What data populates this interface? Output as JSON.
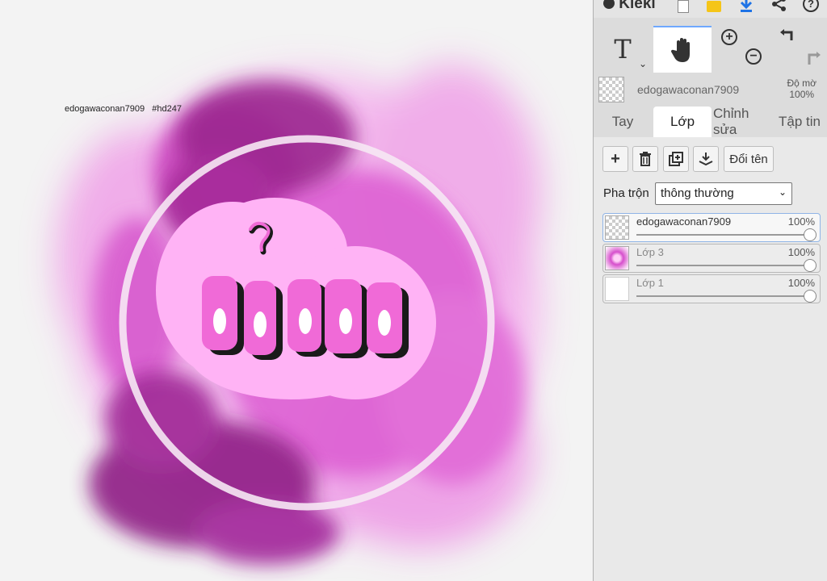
{
  "canvas": {
    "watermark": "edogawaconan7909   #hd247",
    "artwork_text": "ỏ lia",
    "colors": {
      "smoke_light": "#f0a6e8",
      "smoke_mid": "#d84fcf",
      "smoke_dark": "#9a1e8f",
      "badge": "#ffb3f5",
      "letters": "#f06ad7"
    }
  },
  "app": {
    "logo": "Kleki"
  },
  "toolbar": {
    "icons": [
      "square-icon",
      "folder-icon",
      "download-icon",
      "share-icon",
      "help-icon"
    ],
    "tools": [
      "text-tool",
      "hand-tool",
      "zoom-in",
      "zoom-out",
      "undo",
      "redo"
    ],
    "text_tool_label": "T"
  },
  "current_layer": {
    "name": "edogawaconan7909",
    "opacity_label": "Độ mờ",
    "opacity_value": "100%"
  },
  "tabs": [
    "Tay",
    "Lớp",
    "Chỉnh sửa",
    "Tập tin"
  ],
  "active_tab": "Lớp",
  "layer_actions": {
    "rename_label": "Đổi tên"
  },
  "blend": {
    "label": "Pha trộn",
    "value": "thông thường"
  },
  "layers": [
    {
      "name": "edogawaconan7909",
      "opacity": "100%",
      "opacity_fraction": 1.0
    },
    {
      "name": "Lớp 3",
      "opacity": "100%",
      "opacity_fraction": 1.0
    },
    {
      "name": "Lớp 1",
      "opacity": "100%",
      "opacity_fraction": 1.0
    }
  ]
}
